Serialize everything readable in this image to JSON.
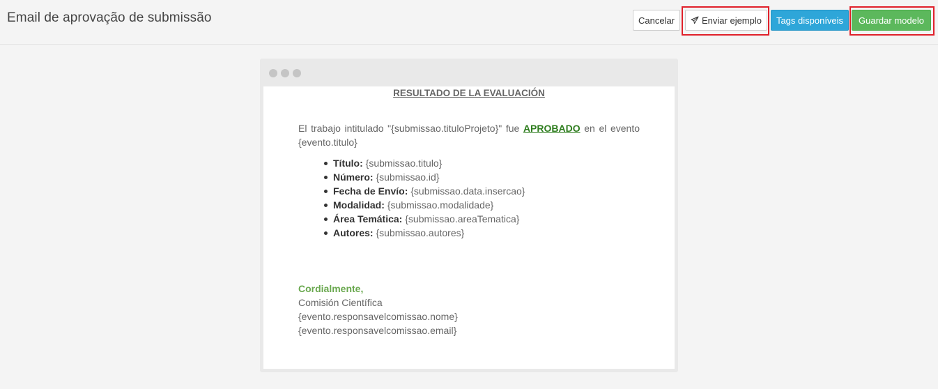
{
  "header": {
    "title": "Email de aprovação de submissão",
    "buttons": {
      "cancel": "Cancelar",
      "send_example": "Enviar ejemplo",
      "tags": "Tags disponíveis",
      "save": "Guardar modelo"
    }
  },
  "email": {
    "heading": "RESULTADO DE LA EVALUACIÓN",
    "intro_before": "El trabajo intitulado \"{submissao.tituloProjeto}\" fue ",
    "intro_status": "APROBADO",
    "intro_after": " en el evento {evento.titulo}",
    "details": [
      {
        "label": "Título:",
        "value": " {submissao.titulo}"
      },
      {
        "label": "Número:",
        "value": " {submissao.id}"
      },
      {
        "label": "Fecha de Envío:",
        "value": " {submissao.data.insercao}"
      },
      {
        "label": "Modalidad:",
        "value": " {submissao.modalidade}"
      },
      {
        "label": "Área Temática:",
        "value": " {submissao.areaTematica}"
      },
      {
        "label": "Autores:",
        "value": " {submissao.autores}"
      }
    ],
    "greeting": "Cordialmente,",
    "signature": [
      "Comisión Científica",
      "{evento.responsavelcomissao.nome}",
      "{evento.responsavelcomissao.email}"
    ]
  },
  "colors": {
    "tags_button": "#2ea6d9",
    "save_button": "#5cb85c",
    "highlight": "#e0202a",
    "approved": "#2e7d1e",
    "greeting": "#6aa84f"
  }
}
